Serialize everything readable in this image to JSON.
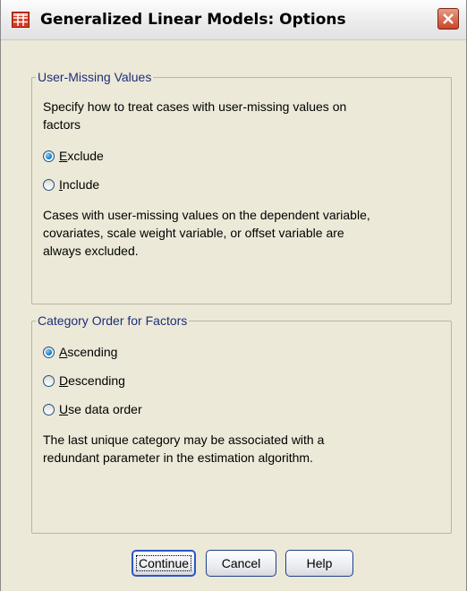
{
  "window": {
    "title": "Generalized Linear Models: Options"
  },
  "user_missing": {
    "legend": "User-Missing Values",
    "description_line1": "Specify how to treat cases with user-missing values on",
    "description_line2": "factors",
    "options": [
      {
        "label": "Exclude",
        "mnemonic": "E",
        "rest": "xclude",
        "selected": true
      },
      {
        "label": "Include",
        "mnemonic": "I",
        "rest": "nclude",
        "selected": false
      }
    ],
    "note_line1": "Cases with user-missing values on the dependent variable,",
    "note_line2": "covariates, scale weight variable, or offset variable are",
    "note_line3": "always excluded."
  },
  "category_order": {
    "legend": "Category Order for Factors",
    "options": [
      {
        "label": "Ascending",
        "mnemonic": "A",
        "rest": "scending",
        "selected": true
      },
      {
        "label": "Descending",
        "mnemonic": "D",
        "rest": "escending",
        "selected": false
      },
      {
        "label": "Use data order",
        "mnemonic": "U",
        "rest": "se data order",
        "selected": false
      }
    ],
    "note_line1": "The last unique category may be associated with a",
    "note_line2": "redundant parameter in the estimation algorithm."
  },
  "buttons": {
    "continue": "Continue",
    "cancel": "Cancel",
    "help": "Help"
  },
  "icons": {
    "app": "spss-grid-icon",
    "close": "close-icon"
  }
}
